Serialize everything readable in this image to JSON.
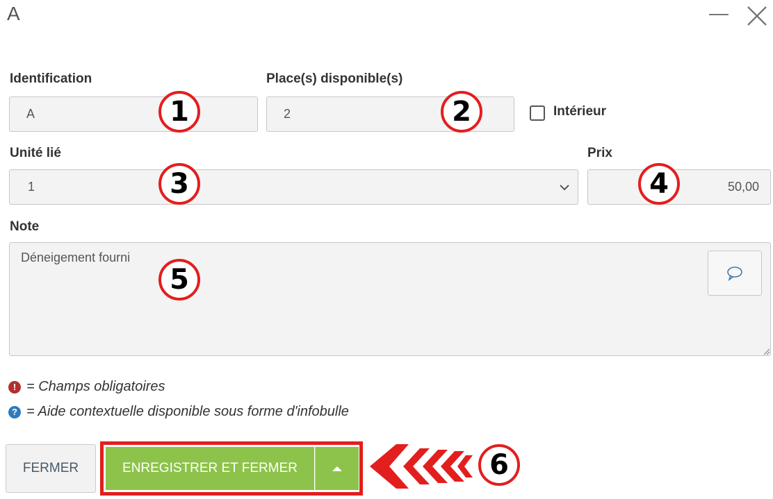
{
  "window": {
    "title": "A"
  },
  "form": {
    "identification": {
      "label": "Identification",
      "value": "A"
    },
    "places": {
      "label": "Place(s) disponible(s)",
      "value": "2"
    },
    "interior": {
      "label": "Intérieur",
      "checked": false
    },
    "unit": {
      "label": "Unité lié",
      "value": "1"
    },
    "price": {
      "label": "Prix",
      "value": "50,00"
    },
    "note": {
      "label": "Note",
      "value": "Déneigement fourni"
    }
  },
  "legend": {
    "required": "= Champs obligatoires",
    "help": "= Aide contextuelle disponible sous forme d'infobulle"
  },
  "buttons": {
    "close": "FERMER",
    "save_close": "ENREGISTRER ET FERMER"
  },
  "annotations": [
    "1",
    "2",
    "3",
    "4",
    "5",
    "6"
  ],
  "colors": {
    "accent_green": "#8dc34a",
    "highlight_red": "#e31e1e",
    "required_icon": "#b03030",
    "help_icon": "#2b7bbf"
  }
}
